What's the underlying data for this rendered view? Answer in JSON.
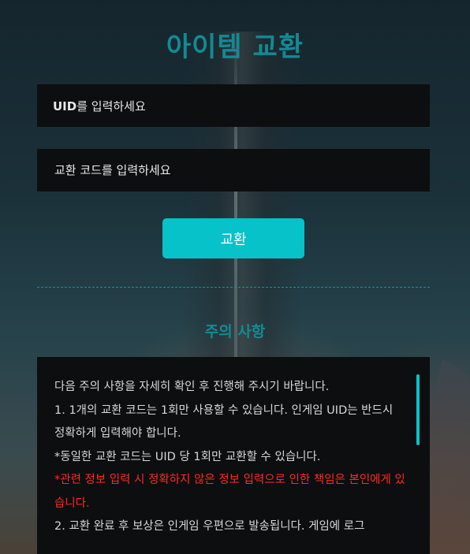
{
  "title": "아이템 교환",
  "uid_input": {
    "placeholder_bold": "UID",
    "placeholder_rest": "를 입력하세요",
    "value": ""
  },
  "code_input": {
    "placeholder": "교환 코드를 입력하세요",
    "value": ""
  },
  "exchange_button": "교환",
  "notice": {
    "title": "주의 사항",
    "lines": [
      {
        "text": "다음 주의 사항을 자세히 확인 후 진행해 주시기 바랍니다.",
        "warning": false
      },
      {
        "text": "1. 1개의 교환 코드는 1회만 사용할 수 있습니다. 인게임 UID는 반드시 정확하게 입력해야 합니다.",
        "warning": false
      },
      {
        "text": "*동일한 교환 코드는 UID 당 1회만 교환할 수 있습니다.",
        "warning": false
      },
      {
        "text": "*관련 정보 입력 시 정확하지 않은 정보 입력으로 인한 책임은 본인에게 있습니다.",
        "warning": true
      },
      {
        "text": "2. 교환 완료 후 보상은 인게임 우편으로 발송됩니다. 게임에 로그",
        "warning": false
      }
    ]
  },
  "colors": {
    "accent": "#07c2c9",
    "title": "#138a94",
    "warning": "#ff2a1f",
    "box_bg": "#0d0e10"
  }
}
